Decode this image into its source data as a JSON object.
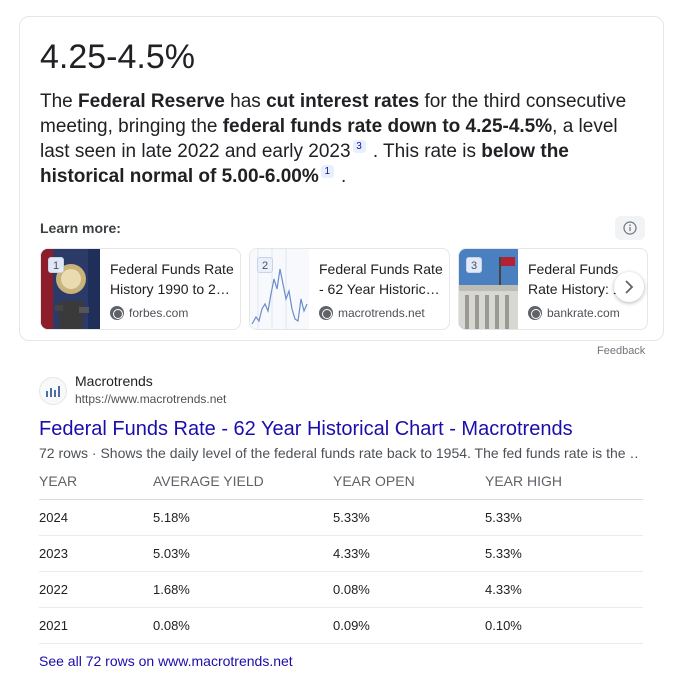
{
  "answer": {
    "headline": "4.25-4.5%",
    "snippet": {
      "p1": "The ",
      "b1": "Federal Reserve",
      "p2": " has ",
      "b2": "cut interest rates",
      "p3": " for the third consecutive meeting, bringing the ",
      "b3": "federal funds rate down to 4.25-4.5%",
      "p4": ", a level last seen in late 2022 and early 2023",
      "cite1": "3",
      "p5": " . This rate is ",
      "b4": "below the historical normal of 5.00-6.00%",
      "cite2": "1",
      "p6": " ."
    },
    "learn_more_label": "Learn more:",
    "info_icon": "info-icon",
    "sources": [
      {
        "num": "1",
        "title": "Federal Funds Rate History 1990 to 2…",
        "domain": "forbes.com",
        "icon": "globe-icon"
      },
      {
        "num": "2",
        "title": "Federal Funds Rate - 62 Year Historic…",
        "domain": "macrotrends.net",
        "icon": "globe-icon"
      },
      {
        "num": "3",
        "title": "Federal Funds Rate History: 1980 Th…",
        "domain": "bankrate.com",
        "icon": "globe-icon"
      }
    ],
    "next_icon": "chevron-right-icon",
    "feedback_label": "Feedback"
  },
  "result": {
    "site_name": "Macrotrends",
    "site_url": "https://www.macrotrends.net",
    "title": "Federal Funds Rate - 62 Year Historical Chart - Macrotrends",
    "description": "72 rows · Shows the daily level of the federal funds rate back to 1954. The fed funds rate is the …",
    "table": {
      "headers": [
        "YEAR",
        "AVERAGE YIELD",
        "YEAR OPEN",
        "YEAR HIGH"
      ],
      "rows": [
        [
          "2024",
          "5.18%",
          "5.33%",
          "5.33%"
        ],
        [
          "2023",
          "5.03%",
          "4.33%",
          "5.33%"
        ],
        [
          "2022",
          "1.68%",
          "0.08%",
          "4.33%"
        ],
        [
          "2021",
          "0.08%",
          "0.09%",
          "0.10%"
        ]
      ]
    },
    "see_all": "See all 72 rows on www.macrotrends.net"
  },
  "colors": {
    "link": "#1a0dab",
    "text": "#202124",
    "muted": "#4d5156",
    "border": "#e6e6e6"
  }
}
